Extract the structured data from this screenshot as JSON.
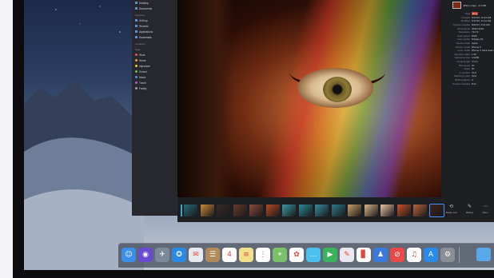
{
  "finder": {
    "places": [
      "Desktop",
      "Documents"
    ],
    "favorites_header": "Favorites",
    "favorites": [
      "AirDrop",
      "Recents",
      "Applications",
      "Downloads"
    ],
    "locations_header": "Locations",
    "tags_header": "Tags",
    "tags": [
      {
        "label": "Work",
        "color": "#e15353"
      },
      {
        "label": "Home",
        "color": "#f29a38"
      },
      {
        "label": "Important",
        "color": "#f3d04a"
      },
      {
        "label": "School",
        "color": "#5cc25a"
      },
      {
        "label": "Music",
        "color": "#4a90e8"
      },
      {
        "label": "Travel",
        "color": "#a064d4"
      },
      {
        "label": "Family",
        "color": "#9a9ea6"
      }
    ]
  },
  "inspector": {
    "file_caption": "JPEG image - 3.6 MB",
    "rows": [
      {
        "k": "Tags",
        "v": "Red",
        "tag": true
      },
      {
        "k": "Created",
        "v": "5/12/15, 11:24 AM"
      },
      {
        "k": "Modified",
        "v": "5/12/15, 11:24 AM"
      },
      {
        "k": "Content created",
        "v": "8/22/17, 6:01 AM"
      },
      {
        "k": "Dimensions",
        "v": "4032×3024"
      },
      {
        "k": "Resolution",
        "v": "72×72"
      },
      {
        "k": "Color space",
        "v": "RGB"
      },
      {
        "k": "Color profile",
        "v": "Display P3"
      },
      {
        "k": "Device make",
        "v": "Apple"
      },
      {
        "k": "Device model",
        "v": "iPhone X"
      },
      {
        "k": "Lens model",
        "v": "iPhone X back dual camera 6mm f/2"
      },
      {
        "k": "Aperture value",
        "v": "1.69"
      },
      {
        "k": "Exposure time",
        "v": "1/1283"
      },
      {
        "k": "Focal length",
        "v": "4 mm"
      },
      {
        "k": "ISO speed",
        "v": "20"
      },
      {
        "k": "Flash",
        "v": "No"
      },
      {
        "k": "F number",
        "v": "f/1.8"
      },
      {
        "k": "Metering mode",
        "v": "Spot"
      },
      {
        "k": "White balance",
        "v": "0"
      },
      {
        "k": "Content Created",
        "v": "8:21"
      }
    ]
  },
  "filmstrip": {
    "thumbs": [
      "#2a6a78",
      "#c98a3a",
      "#3a2a2a",
      "#6a3a2a",
      "#8a4a3a",
      "#b84a22",
      "#3a9aa8",
      "#2a8a98",
      "#3a8aa0",
      "#2a7a88",
      "#c8a26a",
      "#d8b48a",
      "#e8c2a2",
      "#c8522a",
      "#b8623a",
      "#3a2418"
    ],
    "selected_index": 15
  },
  "quick_actions": [
    {
      "label": "Rotate Left",
      "glyph": "⟲"
    },
    {
      "label": "Markup",
      "glyph": "✎"
    },
    {
      "label": "More...",
      "glyph": "⋯"
    }
  ],
  "dock": {
    "apps": [
      {
        "name": "finder-icon",
        "color": "#3b8fe8",
        "glyph": "☺"
      },
      {
        "name": "siri-icon",
        "color": "#6a4ad0",
        "glyph": "◉"
      },
      {
        "name": "launchpad-icon",
        "color": "#7a8a9a",
        "glyph": "✈"
      },
      {
        "name": "safari-icon",
        "color": "#2a8ae8",
        "glyph": "✪"
      },
      {
        "name": "mail-icon",
        "color": "#e6e9ee",
        "glyph": "✉"
      },
      {
        "name": "contacts-icon",
        "color": "#b08a5a",
        "glyph": "☰"
      },
      {
        "name": "calendar-icon",
        "color": "#ffffff",
        "glyph": "4"
      },
      {
        "name": "notes-icon",
        "color": "#f3e08a",
        "glyph": "≡"
      },
      {
        "name": "reminders-icon",
        "color": "#ffffff",
        "glyph": "⋮"
      },
      {
        "name": "maps-icon",
        "color": "#7ac26a",
        "glyph": "⌖"
      },
      {
        "name": "photos-icon",
        "color": "#ffffff",
        "glyph": "✿"
      },
      {
        "name": "messages-icon",
        "color": "#4ac0f0",
        "glyph": "…"
      },
      {
        "name": "facetime-icon",
        "color": "#3ab45a",
        "glyph": "▶"
      },
      {
        "name": "keynote-icon",
        "color": "#e8e8ee",
        "glyph": "✎"
      },
      {
        "name": "numbers-icon",
        "color": "#ffffff",
        "glyph": "▊"
      },
      {
        "name": "keynote-podium-icon",
        "color": "#3a7ae0",
        "glyph": "♟"
      },
      {
        "name": "news-icon",
        "color": "#e84a4a",
        "glyph": "⊘"
      },
      {
        "name": "music-icon",
        "color": "#ffffff",
        "glyph": "♫"
      },
      {
        "name": "app-store-icon",
        "color": "#2a8ae8",
        "glyph": "A"
      },
      {
        "name": "system-preferences-icon",
        "color": "#8a8e96",
        "glyph": "⚙"
      }
    ]
  }
}
